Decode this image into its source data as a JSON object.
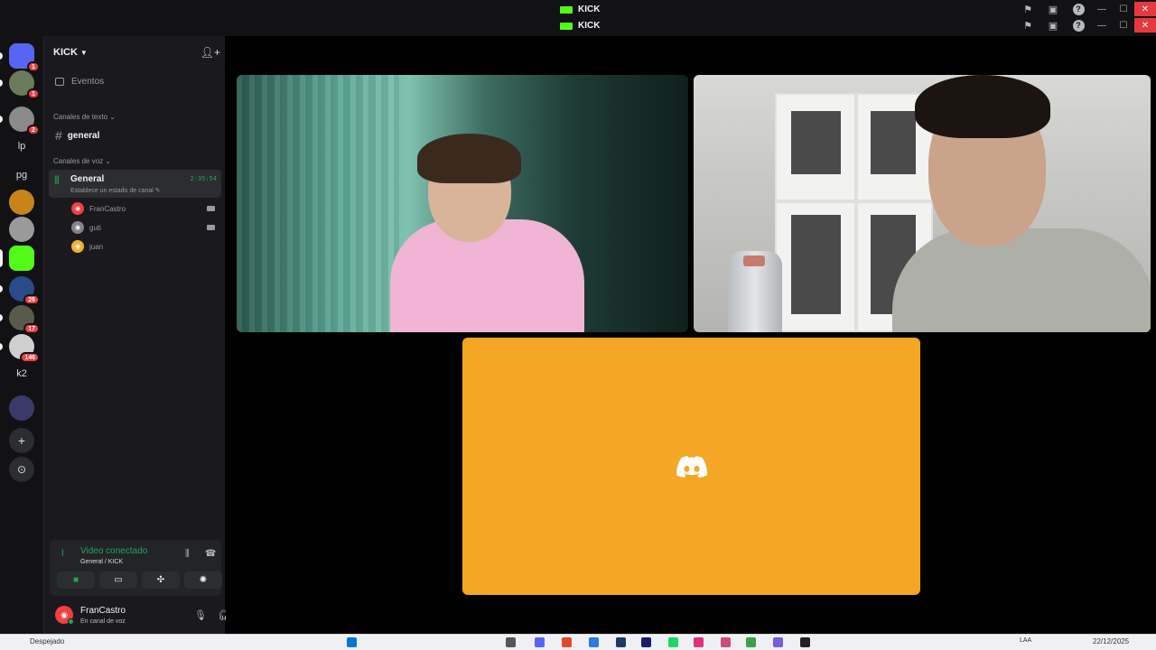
{
  "window": {
    "title_line_1": "KICK",
    "title_line_2": "KICK"
  },
  "server_rail": {
    "items": [
      {
        "name": "home",
        "badge": "1",
        "color": "#5865f2"
      },
      {
        "name": "server-1",
        "badge": "1",
        "color": "#6a7a5a"
      },
      {
        "name": "server-2",
        "badge": "2",
        "color": "#8a8a8a"
      },
      {
        "name": "server-lp",
        "label": "lp",
        "badge": "",
        "color": "#121214"
      },
      {
        "name": "server-pg",
        "label": "pg",
        "badge": "",
        "color": "#121214"
      },
      {
        "name": "server-3",
        "badge": "",
        "color": "#c8841a"
      },
      {
        "name": "server-4",
        "badge": "",
        "color": "#9a9a9a"
      },
      {
        "name": "server-kick",
        "badge": "",
        "color": "#53fc18"
      },
      {
        "name": "server-5",
        "badge": "26",
        "color": "#2a4a8a"
      },
      {
        "name": "server-6",
        "badge": "17",
        "color": "#5a5a4a"
      },
      {
        "name": "server-7",
        "badge": "146",
        "color": "#cfcfcf"
      },
      {
        "name": "server-k2",
        "label": "k2",
        "badge": "",
        "color": "#121214"
      },
      {
        "name": "server-8",
        "badge": "",
        "color": "#3a3a6a"
      }
    ]
  },
  "sidebar": {
    "guild_name": "KICK",
    "events_label": "Eventos",
    "text_category": "Canales de texto",
    "text_channel": "general",
    "voice_category": "Canales de voz",
    "voice_channel": {
      "name": "General",
      "status": "Establece un estado de canal",
      "timer": "2:35:54"
    },
    "members": [
      {
        "name": "FranCastro",
        "color": "#f23f42",
        "camera": true
      },
      {
        "name": "guti",
        "color": "#80848e",
        "camera": true
      },
      {
        "name": "juan",
        "color": "#f0b232",
        "camera": false
      }
    ]
  },
  "voice_panel": {
    "title": "Video conectado",
    "subtitle": "General / KICK"
  },
  "user": {
    "name": "FranCastro",
    "status": "En canal de voz"
  },
  "taskbar": {
    "weather": "Despejado",
    "language": "LAA",
    "date": "22/12/2025"
  },
  "colors": {
    "accent_green": "#23a55a",
    "kick_green": "#53fc18",
    "orange_tile": "#f3a724",
    "discord_red": "#f23f42"
  }
}
